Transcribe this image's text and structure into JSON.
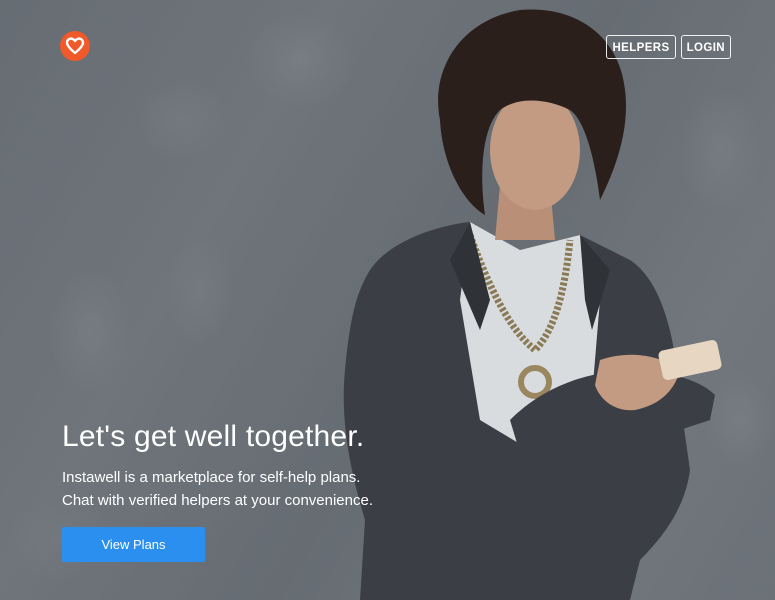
{
  "brand": {
    "logo_icon": "heart-icon",
    "accent_color": "#f0592a"
  },
  "nav": {
    "items": [
      {
        "label": "HELPERS"
      },
      {
        "label": "LOGIN"
      }
    ]
  },
  "hero": {
    "headline": "Let's get well together.",
    "description_line1": "Instawell is a marketplace for self-help plans.",
    "description_line2": "Chat with verified helpers at your convenience.",
    "cta_label": "View Plans",
    "cta_color": "#2b8ff0"
  }
}
